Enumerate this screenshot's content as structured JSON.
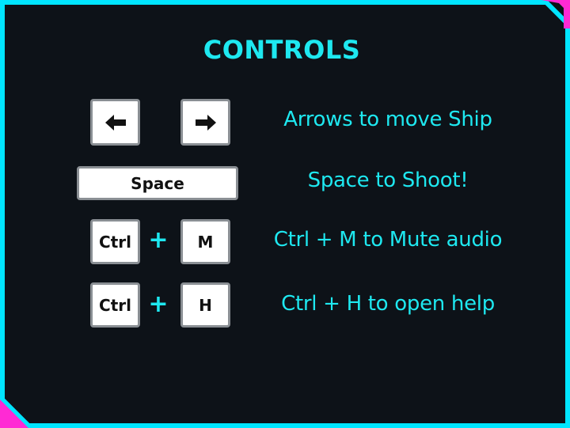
{
  "title": "CONTROLS",
  "colors": {
    "background": "#0d1218",
    "accent": "#1ee8f0",
    "border": "#00e5ff",
    "corner": "#ff2ad4",
    "key_face": "#ffffff",
    "key_border": "#8a8f94"
  },
  "rows": [
    {
      "keys": [
        "left-arrow-icon",
        "right-arrow-icon"
      ],
      "description": "Arrows to move Ship"
    },
    {
      "keys": [
        "Space"
      ],
      "description": "Space to Shoot!"
    },
    {
      "keys": [
        "Ctrl",
        "M"
      ],
      "joiner": "+",
      "description": "Ctrl + M to Mute audio"
    },
    {
      "keys": [
        "Ctrl",
        "H"
      ],
      "joiner": "+",
      "description": "Ctrl + H to open help"
    }
  ]
}
